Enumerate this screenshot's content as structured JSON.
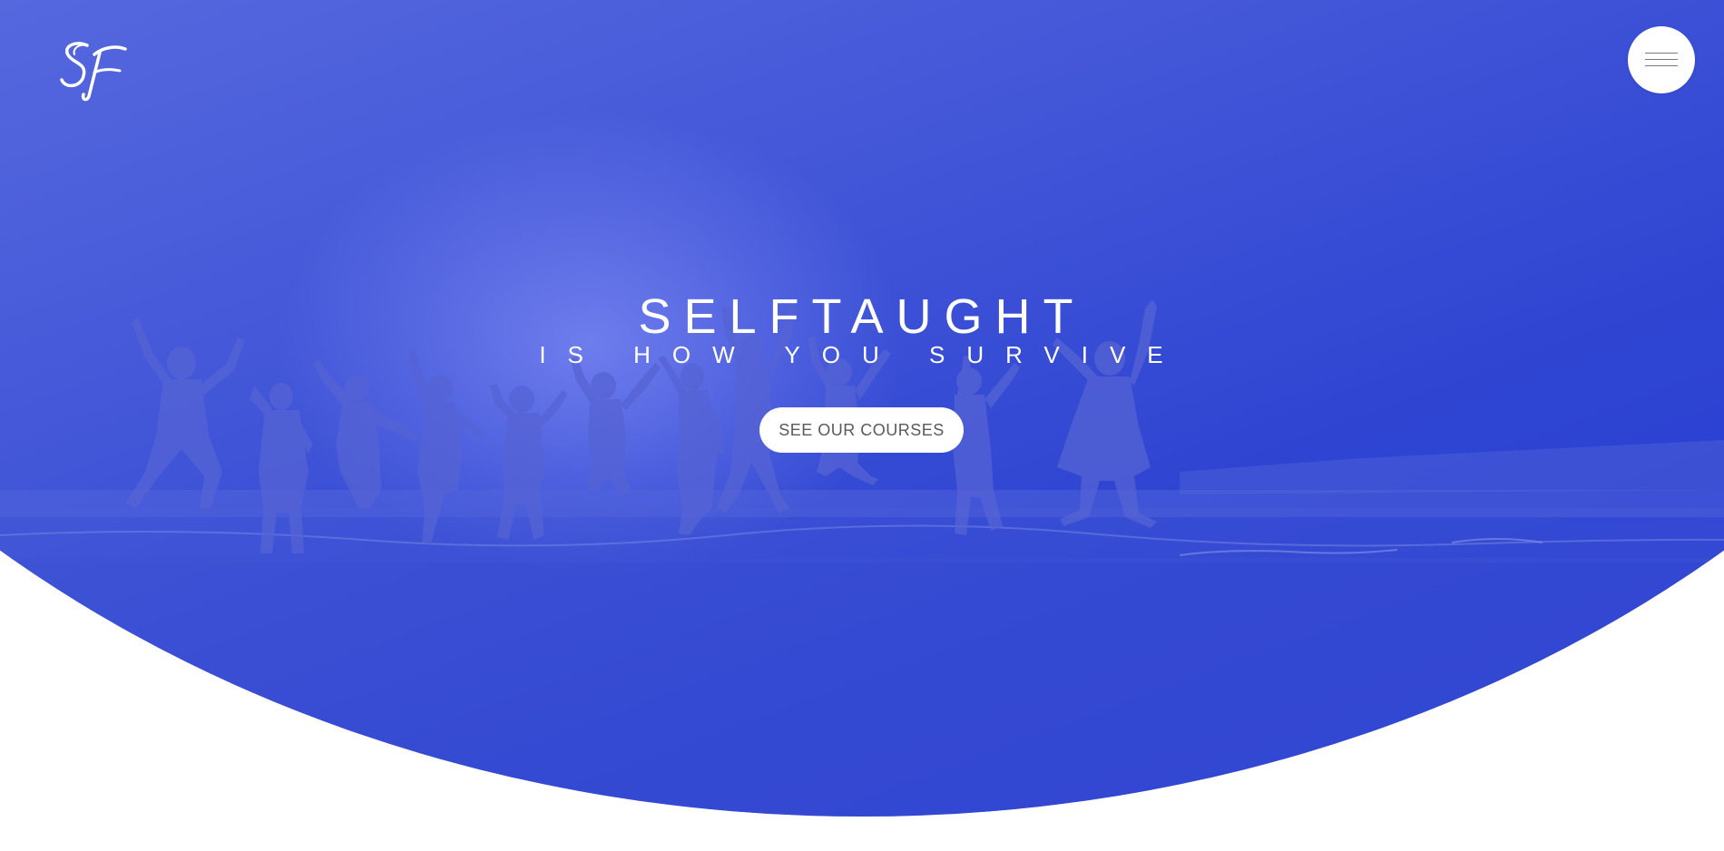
{
  "brand": {
    "logo_text": "SF",
    "logo_icon": "sf-script-logo-icon"
  },
  "header": {
    "menu_icon": "hamburger-menu-icon"
  },
  "hero": {
    "title": "SELFTAUGHT",
    "subtitle": "IS HOW YOU SURVIVE",
    "cta_label": "SEE OUR COURSES",
    "background_image": "silhouettes-of-people-jumping-on-beach",
    "gradient_colors": [
      "#7b86de",
      "#4e61dc",
      "#2236cf"
    ]
  },
  "colors": {
    "hero_start": "#7b86de",
    "hero_end": "#2236cf",
    "button_bg": "#ffffff",
    "button_text": "#5a5a5a",
    "page_bg": "#ffffff"
  }
}
